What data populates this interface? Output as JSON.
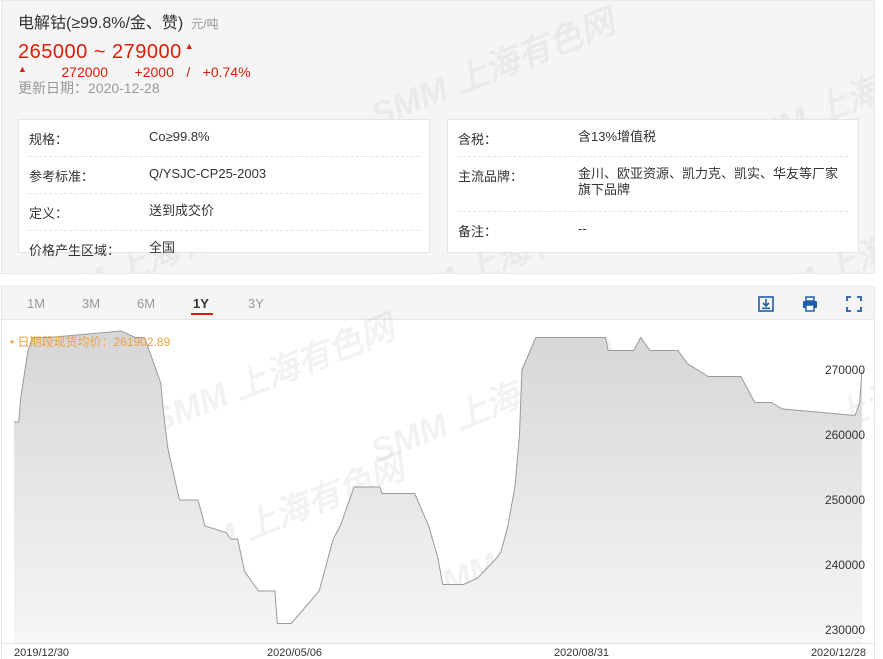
{
  "header": {
    "title": "电解钴(≥99.8%/金、赞)",
    "unit": "元/吨",
    "price_range": "265000 ~ 279000",
    "avg": "272000",
    "change": "+2000",
    "sep": "/",
    "change_pct": "+0.74%",
    "update": "更新日期：2020-12-28"
  },
  "specs_left": [
    {
      "label": "规格：",
      "value": "Co≥99.8%"
    },
    {
      "label": "参考标准：",
      "value": "Q/YSJC-CP25-2003"
    },
    {
      "label": "定义：",
      "value": "送到成交价"
    },
    {
      "label": "价格产生区域：",
      "value": "全国"
    }
  ],
  "specs_right": [
    {
      "label": "含税：",
      "value": "含13%增值税"
    },
    {
      "label": "主流品牌：",
      "value": "金川、欧亚资源、凯力克、凯实、华友等厂家旗下品牌"
    },
    {
      "label": "备注：",
      "value": "--"
    }
  ],
  "watermark": "SMM 上海有色网",
  "tabs": [
    "1M",
    "3M",
    "6M",
    "1Y",
    "3Y"
  ],
  "active_tab": "1Y",
  "toolbar_icons": [
    "download-icon",
    "print-icon",
    "fullscreen-icon"
  ],
  "colors": {
    "accent": "#d81e06",
    "legend": "#f0a040",
    "area": "#e0e0e0",
    "line": "#9a9a9a"
  },
  "chart_data": {
    "type": "area",
    "legend": "日期段现货均价：261902.89",
    "x_labels": [
      "2019/12/30",
      "2020/05/06",
      "2020/08/31",
      "2020/12/28"
    ],
    "y_ticks": [
      230000,
      240000,
      250000,
      260000,
      270000
    ],
    "ylim": [
      228000,
      276000
    ],
    "xlim": [
      "2019-12-30",
      "2020-12-28"
    ],
    "grid": false,
    "x": [
      "2019-12-30",
      "2020-01-01",
      "2020-01-02",
      "2020-01-05",
      "2020-01-07",
      "2020-01-09",
      "2020-01-14",
      "2020-02-14",
      "2020-02-20",
      "2020-02-24",
      "2020-03-02",
      "2020-03-03",
      "2020-03-05",
      "2020-03-10",
      "2020-03-16",
      "2020-03-18",
      "2020-03-21",
      "2020-03-30",
      "2020-04-01",
      "2020-04-04",
      "2020-04-07",
      "2020-04-13",
      "2020-04-20",
      "2020-04-21",
      "2020-04-24",
      "2020-04-27",
      "2020-05-09",
      "2020-05-12",
      "2020-05-15",
      "2020-05-18",
      "2020-05-24",
      "2020-05-30",
      "2020-06-04",
      "2020-06-05",
      "2020-06-19",
      "2020-06-25",
      "2020-06-29",
      "2020-07-01",
      "2020-07-03",
      "2020-07-06",
      "2020-07-08",
      "2020-07-10",
      "2020-07-16",
      "2020-07-24",
      "2020-07-26",
      "2020-07-29",
      "2020-08-01",
      "2020-08-03",
      "2020-08-04",
      "2020-08-10",
      "2020-08-14",
      "2020-08-16",
      "2020-09-09",
      "2020-09-10",
      "2020-09-14",
      "2020-09-21",
      "2020-09-24",
      "2020-09-28",
      "2020-10-10",
      "2020-10-14",
      "2020-10-23",
      "2020-11-06",
      "2020-11-12",
      "2020-11-19",
      "2020-11-24",
      "2020-12-25",
      "2020-12-27",
      "2020-12-28"
    ],
    "series": [
      {
        "values": [
          262000,
          262000,
          266000,
          273000,
          275000,
          275000,
          275000,
          276000,
          275000,
          275000,
          268000,
          264000,
          258000,
          250000,
          250000,
          250000,
          246000,
          245000,
          244000,
          244000,
          239000,
          236000,
          236000,
          231000,
          231000,
          231000,
          236000,
          240000,
          244000,
          246000,
          252000,
          252000,
          252000,
          251000,
          251000,
          246000,
          241000,
          237000,
          237000,
          237000,
          237000,
          237000,
          238000,
          241000,
          242000,
          246000,
          252000,
          260000,
          270000,
          275000,
          275000,
          275000,
          275000,
          273000,
          273000,
          273000,
          275000,
          273000,
          273000,
          271000,
          269000,
          269000,
          265000,
          265000,
          264000,
          263000,
          265000,
          270000
        ]
      }
    ]
  }
}
